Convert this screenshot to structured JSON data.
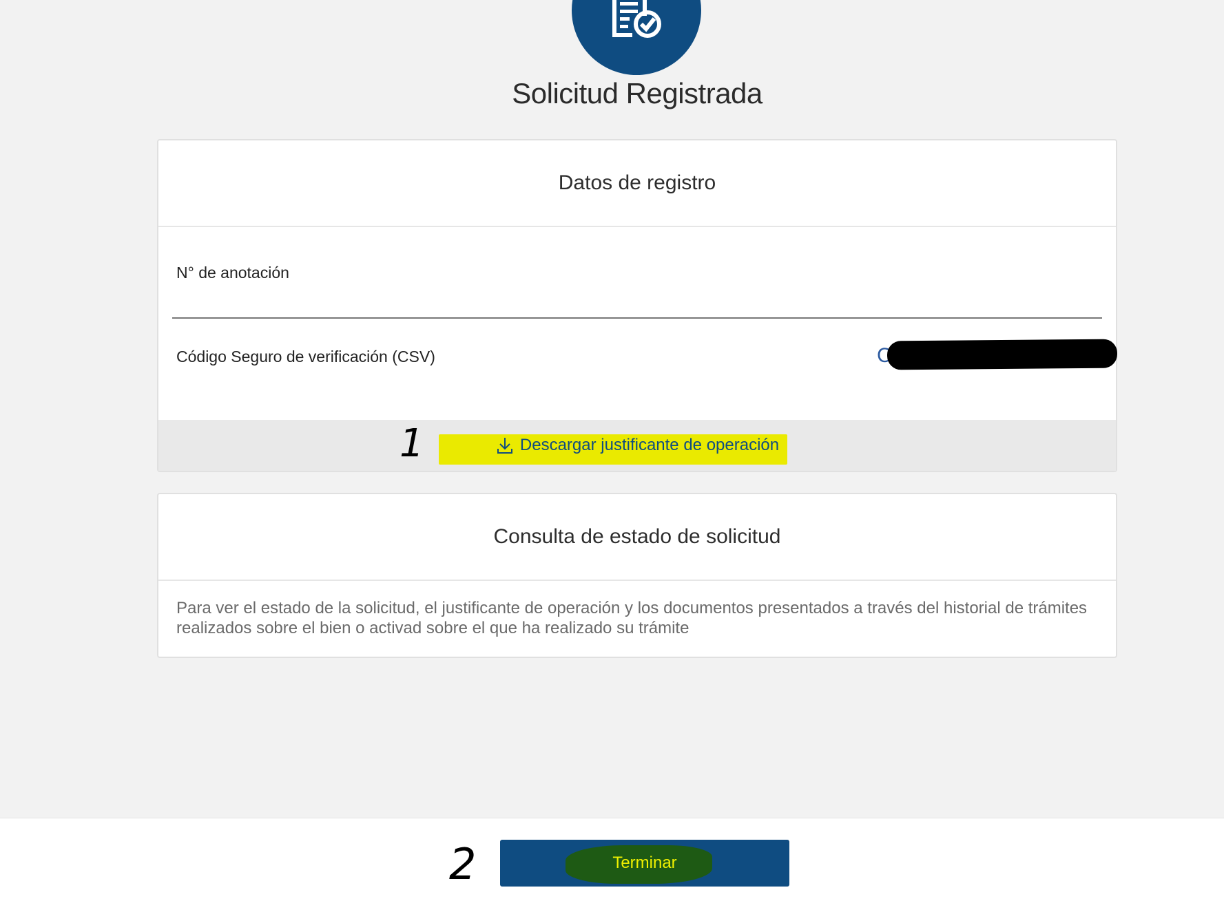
{
  "header": {
    "icon": "document-check-icon",
    "title": "Solicitud Registrada"
  },
  "registro": {
    "title": "Datos de registro",
    "anotacion_label": "N° de anotación",
    "csv_label": "Código Seguro de verificación (CSV)",
    "csv_value_visible": "C",
    "download_icon": "download-icon",
    "download_label": "Descargar justificante de operación"
  },
  "consulta": {
    "title": "Consulta de estado de solicitud",
    "body": "Para ver el estado de la solicitud, el justificante de operación y los documentos presentados a través del historial de trámites realizados sobre el bien o activad sobre el que ha realizado su trámite"
  },
  "annotations": {
    "step1": "1",
    "step2": "2"
  },
  "footer": {
    "terminar_label": "Terminar"
  },
  "colors": {
    "brand_blue": "#0f4c81",
    "highlight_yellow": "#eaea00",
    "background": "#f2f2f2"
  }
}
